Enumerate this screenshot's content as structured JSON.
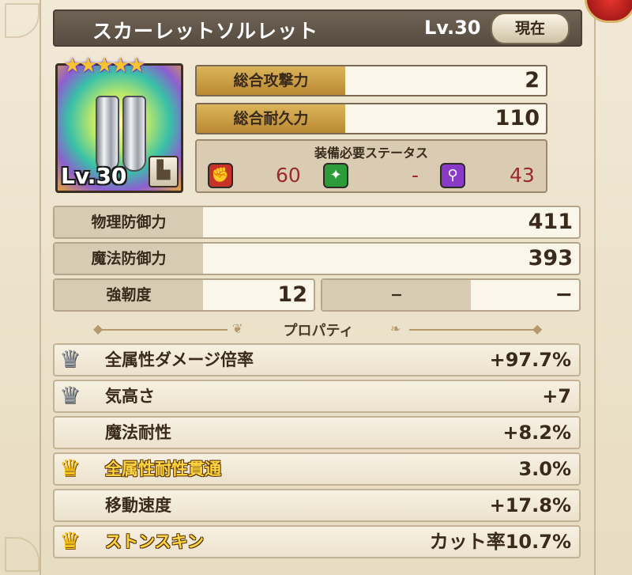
{
  "header": {
    "item_name": "スカーレットソルレット",
    "level": "Lv.30",
    "current_button": "現在"
  },
  "item": {
    "level_badge": "Lv.30",
    "rarity_stars": 5,
    "stars_text": "★★★★★",
    "slot_icon": "boot-icon",
    "slot_glyph": "▙"
  },
  "main_stats": [
    {
      "label": "総合攻撃力",
      "value": "2"
    },
    {
      "label": "総合耐久力",
      "value": "110"
    }
  ],
  "requirements": {
    "title": "装備必要ステータス",
    "items": [
      {
        "icon": "strength-fist-icon",
        "glyph": "✊",
        "color": "#c8302a",
        "value": "60"
      },
      {
        "icon": "dexterity-star-icon",
        "glyph": "✦",
        "color": "#2c9b3a",
        "value": "-"
      },
      {
        "icon": "magic-wand-icon",
        "glyph": "⚲",
        "color": "#8a3ac8",
        "value": "43"
      }
    ]
  },
  "stats": {
    "physical_defense": {
      "label": "物理防御力",
      "value": "411"
    },
    "magic_defense": {
      "label": "魔法防御力",
      "value": "393"
    },
    "toughness": {
      "label": "強靭度",
      "value": "12"
    },
    "empty_slot": {
      "label": "−",
      "value": "−"
    }
  },
  "properties_title": "プロパティ",
  "properties": [
    {
      "crown": "silver",
      "label": "全属性ダメージ倍率",
      "value": "+97.7%",
      "special": false
    },
    {
      "crown": "silver",
      "label": "気高さ",
      "value": "+7",
      "special": false
    },
    {
      "crown": "none",
      "label": "魔法耐性",
      "value": "+8.2%",
      "special": false
    },
    {
      "crown": "gold",
      "label": "全属性耐性貫通",
      "value": "3.0%",
      "special": true
    },
    {
      "crown": "none",
      "label": "移動速度",
      "value": "+17.8%",
      "special": false
    },
    {
      "crown": "gold",
      "label": "ストンスキン",
      "value": "カット率10.7%",
      "special": true
    }
  ],
  "colors": {
    "gold_label": "#c89a40",
    "title_bar": "#5f5446",
    "special_text": "#ffd640"
  }
}
